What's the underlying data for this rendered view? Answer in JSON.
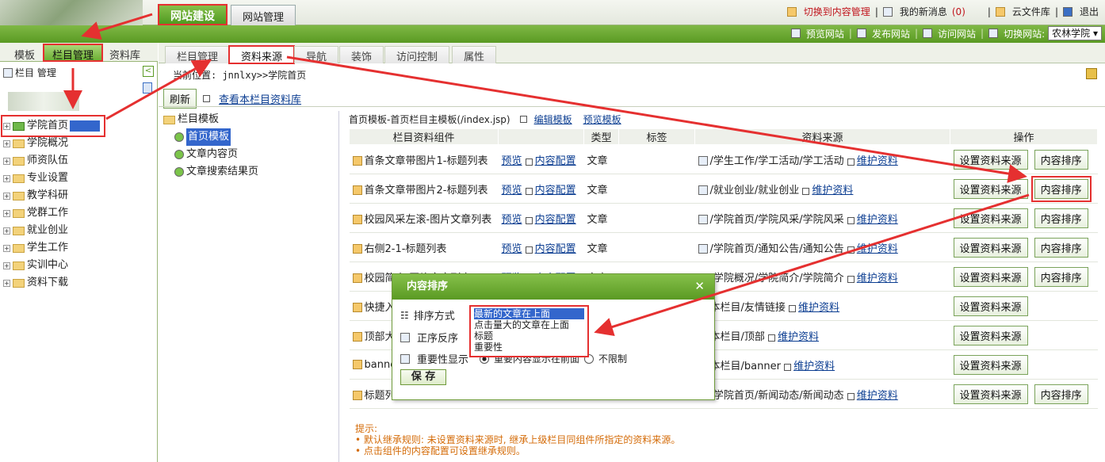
{
  "topbar": {
    "tab_site_build": "网站建设",
    "tab_site_manage": "网站管理",
    "switch_content": "切换到内容管理",
    "my_messages": "我的新消息",
    "msg_count": "(0)",
    "cloud_files": "云文件库",
    "logout": "退出"
  },
  "greenbar": {
    "preview_site": "预览网站",
    "publish_site": "发布网站",
    "visit_site": "访问网站",
    "switch_site": "切换网站:",
    "site_value": "农林学院"
  },
  "left": {
    "tabs": [
      "模板",
      "栏目管理",
      "资料库"
    ],
    "panel_title": "栏目 管理",
    "tree": [
      "学院首页",
      "学院概况",
      "师资队伍",
      "专业设置",
      "教学科研",
      "党群工作",
      "就业创业",
      "学生工作",
      "实训中心",
      "资料下载"
    ]
  },
  "main": {
    "tabs": [
      "栏目管理",
      "资料来源",
      "导航",
      "装饰",
      "访问控制",
      "属性"
    ],
    "breadcrumb": "当前位置: jnnlxy>>学院首页",
    "refresh": "刷新",
    "view_library": "查看本栏目资料库",
    "tpl_root": "栏目模板",
    "tpl_items": [
      "首页模板",
      "文章内容页",
      "文章搜索结果页"
    ],
    "template_title": "首页模板-首页栏目主模板(/index.jsp)",
    "edit_template": "编辑模板",
    "preview_template": "预览模板",
    "headers": [
      "栏目资料组件",
      "",
      "类型",
      "标签",
      "资料来源",
      "操作"
    ]
  },
  "rows": [
    {
      "name": "首条文章带图片1-标题列表",
      "type": "文章",
      "source": "/学生工作/学工活动/学工活动",
      "sort": true
    },
    {
      "name": "首条文章带图片2-标题列表",
      "type": "文章",
      "source": "/就业创业/就业创业",
      "sort": true
    },
    {
      "name": "校园风采左滚-图片文章列表",
      "type": "文章",
      "source": "/学院首页/学院风采/学院风采",
      "sort": true
    },
    {
      "name": "右侧2-1-标题列表",
      "type": "文章",
      "source": "/学院首页/通知公告/通知公告",
      "sort": true
    },
    {
      "name": "校园简介-图片文章列表",
      "type": "文章",
      "source": "/学院概况/学院简介/学院简介",
      "sort": true
    },
    {
      "name": "快捷入口",
      "type": "",
      "source": "本栏目/友情链接",
      "sort": false
    },
    {
      "name": "顶部大图",
      "type": "",
      "source": "本栏目/顶部",
      "sort": false
    },
    {
      "name": "banner",
      "type": "",
      "source": "本栏目/banner",
      "sort": false
    },
    {
      "name": "标题列表",
      "type": "",
      "source": "/学院首页/新闻动态/新闻动态",
      "sort": true
    }
  ],
  "row_labels": {
    "preview": "预览",
    "content_config": "内容配置",
    "maintain": "维护资料",
    "set_source": "设置资料来源",
    "content_sort": "内容排序"
  },
  "tips": {
    "title": "提示:",
    "line1": "默认继承规则: 未设置资料来源时, 继承上级栏目同组件所指定的资料来源。",
    "line2": "点击组件的内容配置可设置继承规则。"
  },
  "modal": {
    "title": "内容排序",
    "sort_method": "排序方式",
    "order": "正序反序",
    "importance": "重要性显示",
    "options": [
      "最新的文章在上面",
      "点击量大的文章在上面",
      "标题",
      "重要性"
    ],
    "radio1": "重要内容显示在前面",
    "radio2": "不限制",
    "save": "保 存"
  }
}
